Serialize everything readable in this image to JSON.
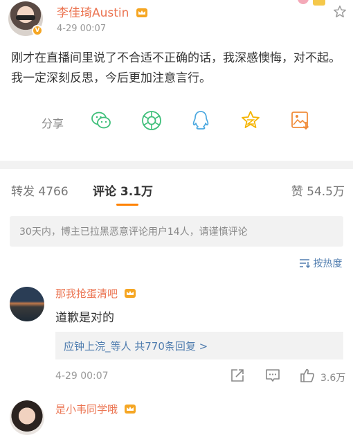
{
  "post": {
    "author": "李佳琦Austin",
    "time": "4-29 00:07",
    "text": "刚才在直播间里说了不合适不正确的话，我深感懊悔，对不起。我一定深刻反思，今后更加注意言行。"
  },
  "share": {
    "label": "分享",
    "icons": [
      "wechat-icon",
      "moments-icon",
      "qq-icon",
      "qzone-star-icon",
      "save-image-icon"
    ]
  },
  "tabs": {
    "repost": "转发 4766",
    "comments": "评论 3.1万",
    "likes": "赞 54.5万"
  },
  "notice": "30天内，博主已拉黑恶意评论用户14人，请谨慎评论",
  "sort_label": "按热度",
  "comments": [
    {
      "name": "那我抢蛋清吧",
      "text": "道歉是对的",
      "reply_summary": "应钟上浣_等人  共770条回复 >",
      "time": "4-29 00:07",
      "likes": "3.6万"
    },
    {
      "name": "是小韦同学哦",
      "text": ""
    }
  ],
  "colors": {
    "name": "#eb7350",
    "link": "#507daf",
    "accent": "#ff8200",
    "icon_green": "#3fbf7a",
    "icon_blue": "#4aa8e0",
    "icon_yellow": "#f5b400",
    "icon_orange": "#f08c3a"
  }
}
